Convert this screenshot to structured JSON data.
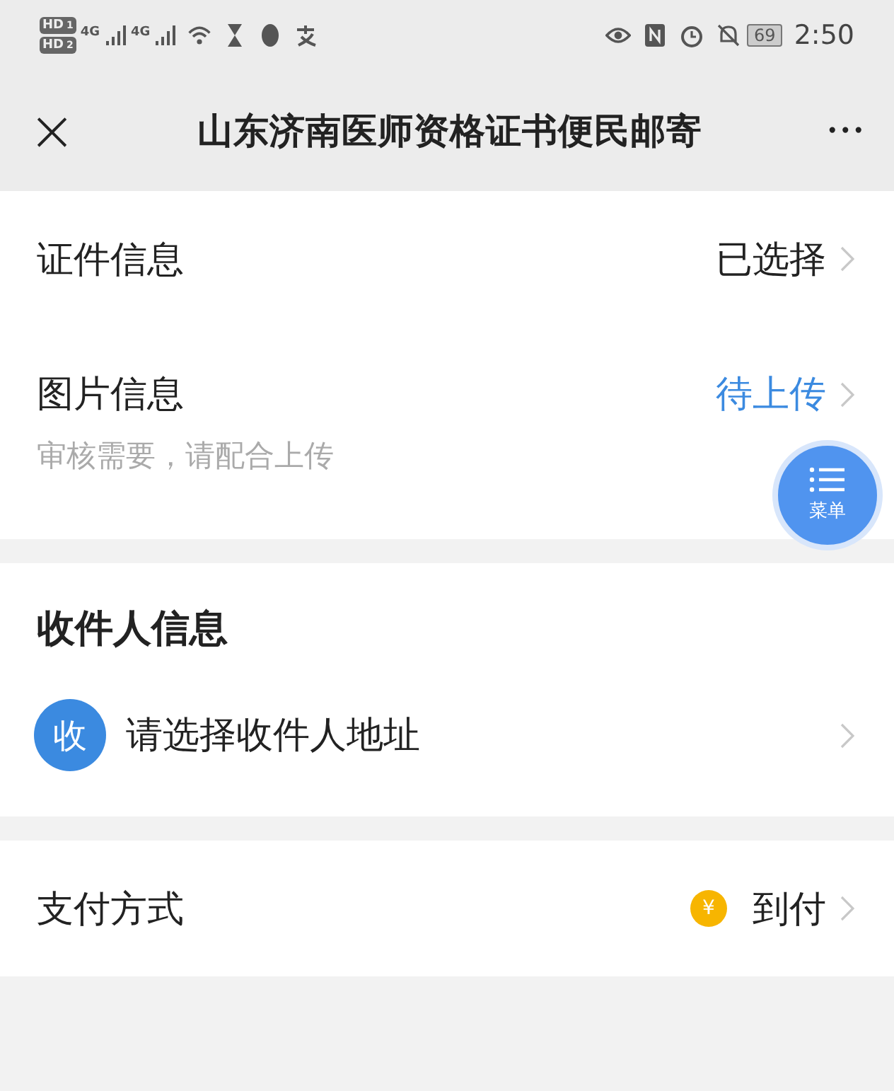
{
  "status_bar": {
    "sims": [
      {
        "badge": "HD",
        "slot": "1",
        "network": "4G"
      },
      {
        "badge": "HD",
        "slot": "2",
        "network": "4G"
      }
    ],
    "battery": "69",
    "time": "2:50"
  },
  "title_bar": {
    "close": "×",
    "title": "山东济南医师资格证书便民邮寄",
    "more": "•••"
  },
  "info_rows": [
    {
      "label": "证件信息",
      "value": "已选择",
      "highlighted": false
    },
    {
      "label": "图片信息",
      "value": "待上传",
      "highlighted": true,
      "hint": "审核需要，请配合上传"
    }
  ],
  "recipient": {
    "heading": "收件人信息",
    "badge": "收",
    "address_prompt": "请选择收件人地址"
  },
  "payment": {
    "label": "支付方式",
    "coin": "¥",
    "value": "到付"
  },
  "floating_menu": {
    "label": "菜单"
  }
}
